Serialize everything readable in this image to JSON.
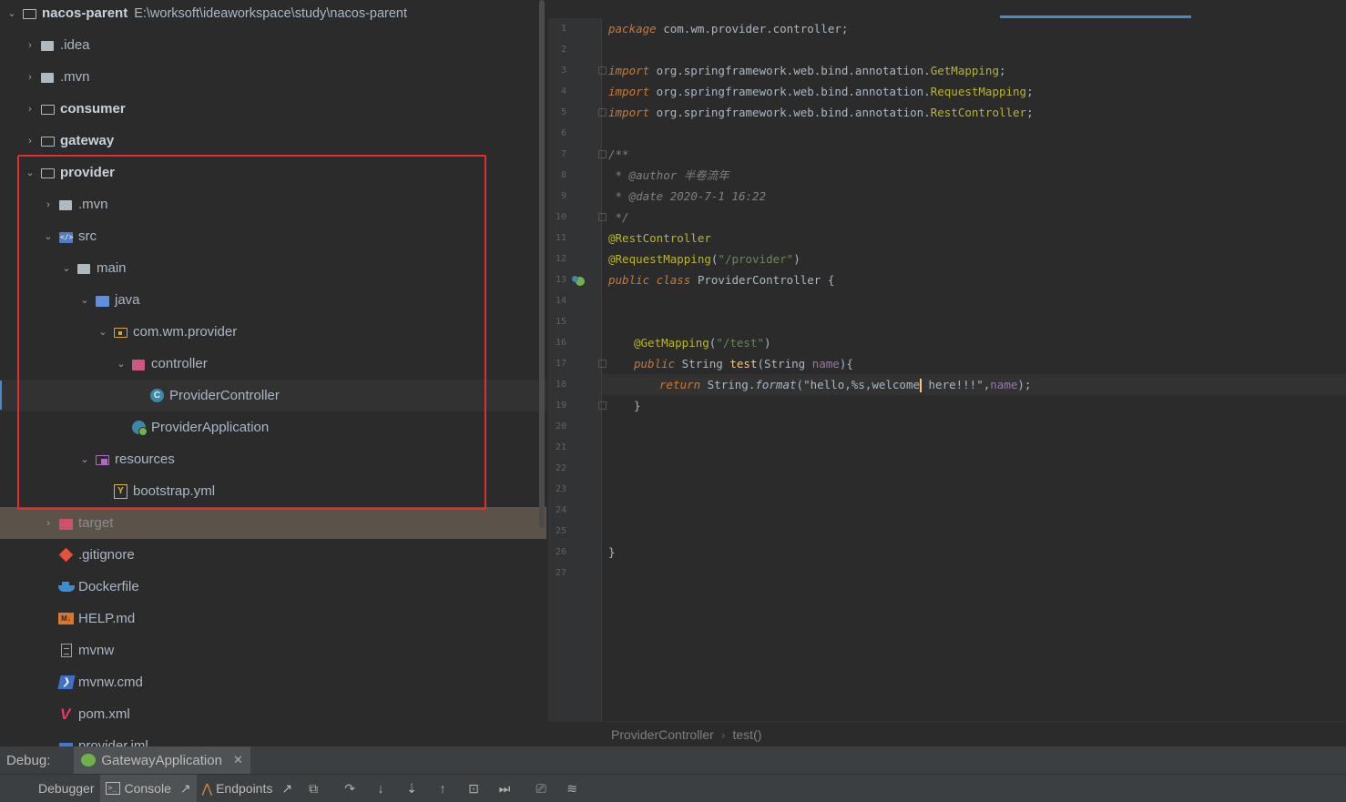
{
  "project_tree": {
    "root": {
      "name": "nacos-parent",
      "path": "E:\\worksoft\\ideaworkspace\\study\\nacos-parent"
    },
    "items": [
      {
        "label": ".idea"
      },
      {
        "label": ".mvn"
      },
      {
        "label": "consumer"
      },
      {
        "label": "gateway"
      },
      {
        "label": "provider"
      },
      {
        "label": ".mvn"
      },
      {
        "label": "src"
      },
      {
        "label": "main"
      },
      {
        "label": "java"
      },
      {
        "label": "com.wm.provider"
      },
      {
        "label": "controller"
      },
      {
        "label": "ProviderController"
      },
      {
        "label": "ProviderApplication"
      },
      {
        "label": "resources"
      },
      {
        "label": "bootstrap.yml"
      },
      {
        "label": "target"
      },
      {
        "label": ".gitignore"
      },
      {
        "label": "Dockerfile"
      },
      {
        "label": "HELP.md"
      },
      {
        "label": "mvnw"
      },
      {
        "label": "mvnw.cmd"
      },
      {
        "label": "pom.xml"
      },
      {
        "label": "provider.iml"
      }
    ]
  },
  "editor": {
    "line_numbers": [
      "1",
      "2",
      "3",
      "4",
      "5",
      "6",
      "7",
      "8",
      "9",
      "10",
      "11",
      "12",
      "13",
      "14",
      "15",
      "16",
      "17",
      "18",
      "19",
      "20",
      "21",
      "22",
      "23",
      "24",
      "25",
      "26",
      "27"
    ],
    "code": {
      "l1_kw": "package",
      "l1_rest": " com.wm.provider.controller;",
      "l3_kw": "import",
      "l3_rest": " org.springframework.web.bind.annotation.",
      "l3_cls": "GetMapping",
      "l4_kw": "import",
      "l4_rest": " org.springframework.web.bind.annotation.",
      "l4_cls": "RequestMapping",
      "l5_kw": "import",
      "l5_rest": " org.springframework.web.bind.annotation.",
      "l5_cls": "RestController",
      "l7": "/**",
      "l8_star": " * ",
      "l8_tag": "@author",
      "l8_val": " 半卷流年",
      "l9_star": " * ",
      "l9_tag": "@date",
      "l9_val": " 2020-7-1 16:22",
      "l10": " */",
      "l11": "@RestController",
      "l12_ann": "@RequestMapping",
      "l12_open": "(",
      "l12_str": "\"/provider\"",
      "l12_close": ")",
      "l13_kw1": "public",
      "l13_kw2": "class",
      "l13_rest": " ProviderController {",
      "l16_ann": "@GetMapping",
      "l16_open": "(",
      "l16_str": "\"/test\"",
      "l16_close": ")",
      "l17_kw": "public",
      "l17_type": " String ",
      "l17_method": "test",
      "l17_open": "(String ",
      "l17_param": "name",
      "l17_close": "){",
      "l18_kw": "return",
      "l18_cls": " String.",
      "l18_call": "format",
      "l18_open": "(",
      "l18_str1": "\"hello,%s,welcome",
      "l18_str2": " here!!!\"",
      "l18_comma": ",",
      "l18_param": "name",
      "l18_close": ");",
      "l19": "}",
      "l26": "}"
    },
    "breadcrumb": [
      "ProviderController",
      "test()"
    ],
    "breadcrumb_sep": "›"
  },
  "debug": {
    "title": "Debug:",
    "session": "GatewayApplication",
    "close": "✕",
    "tabs": {
      "debugger": "Debugger",
      "console": "Console",
      "endpoints": "Endpoints"
    }
  },
  "colors": {
    "highlight_box": "#e0302e",
    "spring_green": "#6fb24a"
  }
}
